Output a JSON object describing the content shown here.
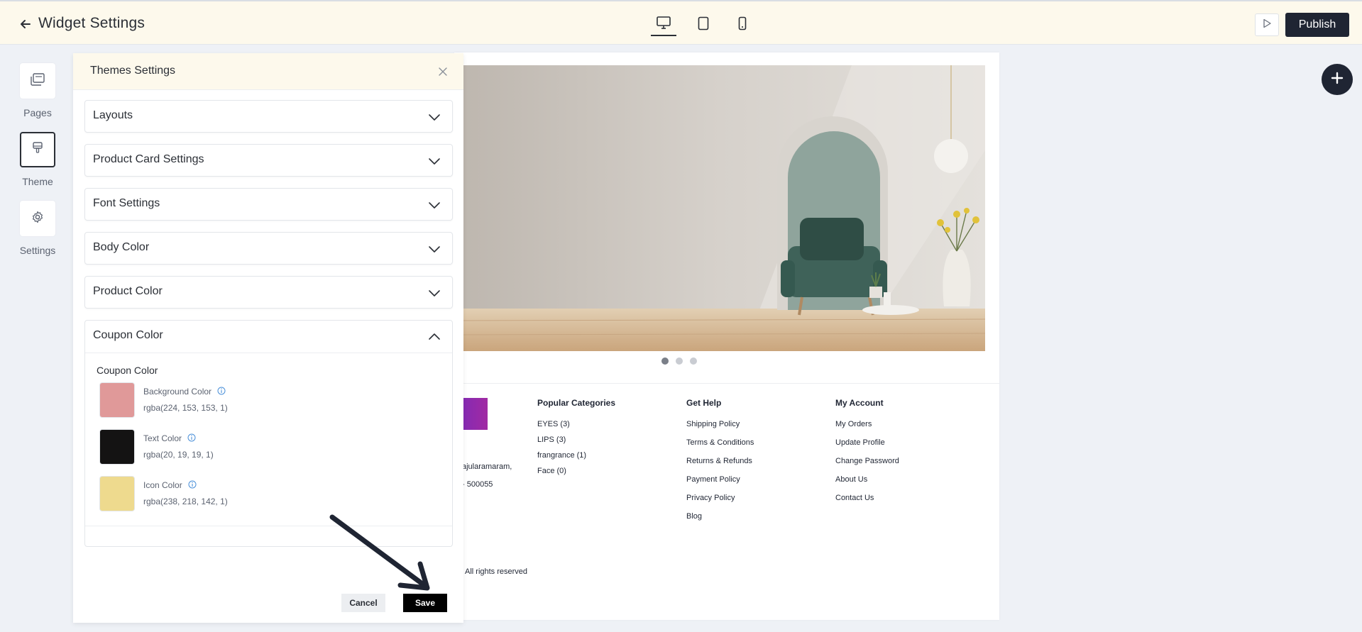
{
  "header": {
    "title": "Widget Settings",
    "publish_label": "Publish"
  },
  "rail": {
    "items": [
      {
        "label": "Pages",
        "icon": "pages-icon"
      },
      {
        "label": "Theme",
        "icon": "brush-icon"
      },
      {
        "label": "Settings",
        "icon": "gear-icon"
      }
    ]
  },
  "panel": {
    "title": "Themes Settings",
    "sections": [
      {
        "label": "Layouts"
      },
      {
        "label": "Product Card Settings"
      },
      {
        "label": "Font Settings"
      },
      {
        "label": "Body Color"
      },
      {
        "label": "Product Color"
      }
    ],
    "open_section": {
      "label": "Coupon Color",
      "sub_title": "Coupon Color",
      "colors": [
        {
          "name": "Background Color",
          "value": "rgba(224, 153, 153, 1)",
          "swatch": "#e09999"
        },
        {
          "name": "Text Color",
          "value": "rgba(20, 19, 19, 1)",
          "swatch": "#141313"
        },
        {
          "name": "Icon Color",
          "value": "rgba(238, 218, 142, 1)",
          "swatch": "#eeda8e"
        }
      ]
    },
    "cancel_label": "Cancel",
    "save_label": "Save"
  },
  "preview": {
    "footer": {
      "address_line1": "ajularamaram,",
      "address_line2": "- 500055",
      "copyright": "All rights reserved",
      "categories": {
        "heading": "Popular Categories",
        "links": [
          "EYES (3)",
          "LIPS (3)",
          "frangrance (1)",
          "Face (0)"
        ]
      },
      "help": {
        "heading": "Get Help",
        "links": [
          "Shipping Policy",
          "Terms & Conditions",
          "Returns & Refunds",
          "Payment Policy",
          "Privacy Policy",
          "Blog"
        ]
      },
      "account": {
        "heading": "My Account",
        "links": [
          "My Orders",
          "Update Profile",
          "Change Password",
          "About Us",
          "Contact Us"
        ]
      }
    }
  },
  "colors": {
    "accent_dark": "#1f2533",
    "header_bg": "#fdf9ec",
    "canvas_bg": "#eef1f6"
  }
}
